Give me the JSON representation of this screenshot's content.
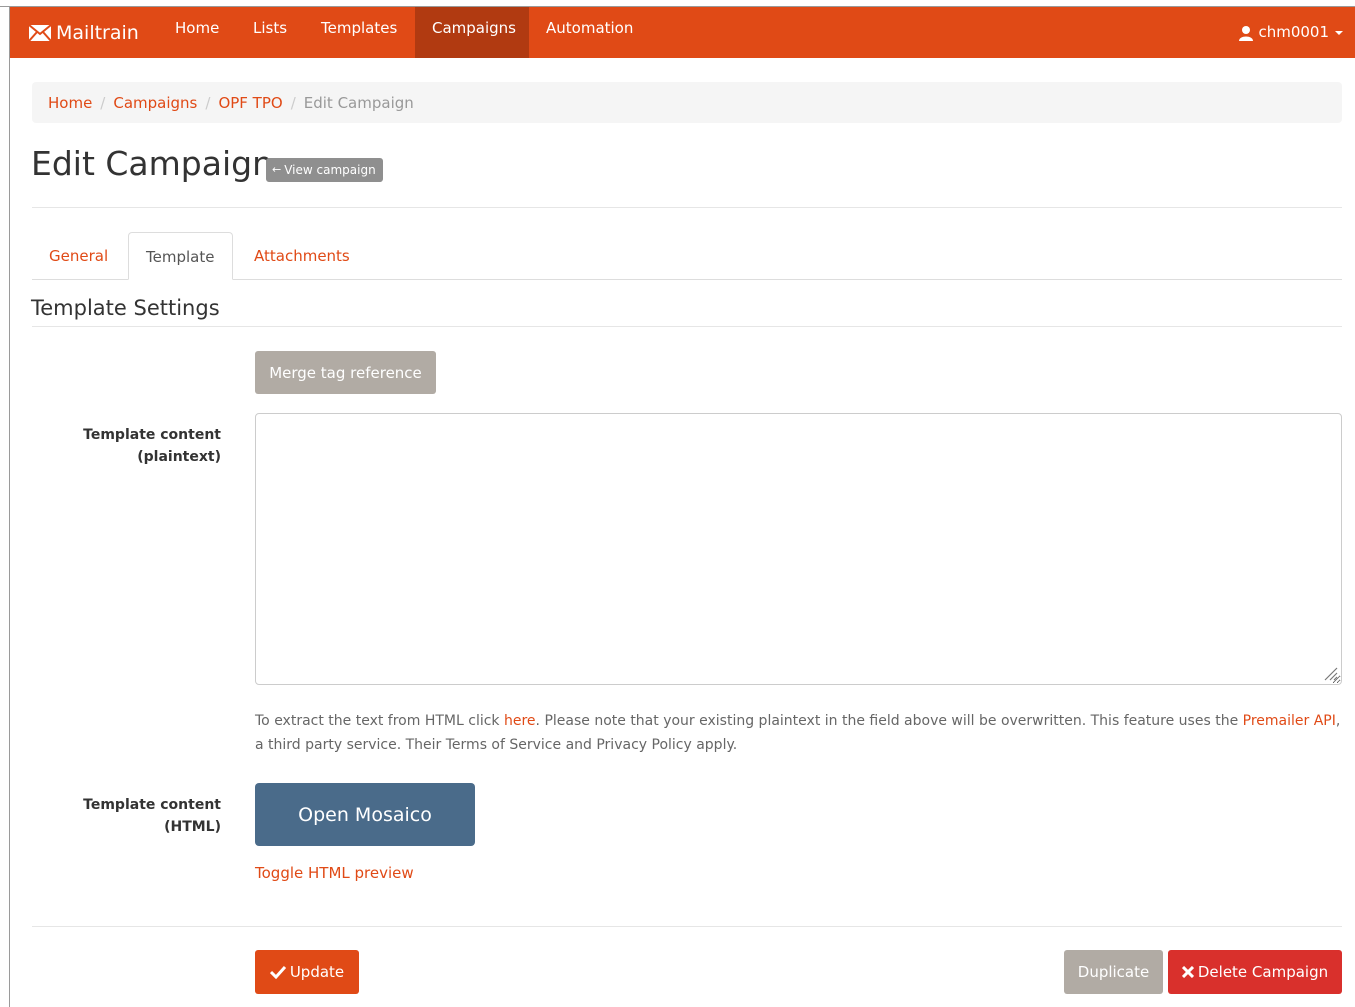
{
  "colors": {
    "accent": "#e04a16",
    "nav_active": "#b13a11",
    "mosaico": "#4a6b8a",
    "danger": "#d9302c",
    "muted_button": "#b1aba4"
  },
  "navbar": {
    "brand": "Mailtrain",
    "items": [
      {
        "label": "Home"
      },
      {
        "label": "Lists"
      },
      {
        "label": "Templates"
      },
      {
        "label": "Campaigns"
      },
      {
        "label": "Automation"
      }
    ],
    "active_item": "Campaigns",
    "user": "chm0001"
  },
  "breadcrumb": {
    "items": [
      "Home",
      "Campaigns",
      "OPF TPO"
    ],
    "current": "Edit Campaign",
    "separator": "/"
  },
  "header": {
    "title": "Edit Campaign",
    "view_button": "View campaign"
  },
  "tabs": {
    "items": [
      {
        "label": "General"
      },
      {
        "label": "Template"
      },
      {
        "label": "Attachments"
      }
    ],
    "active": "Template"
  },
  "template_settings": {
    "title": "Template Settings",
    "merge_tag_button": "Merge tag reference",
    "plaintext_label_line1": "Template content",
    "plaintext_label_line2": "(plaintext)",
    "plaintext_value": "",
    "help_text_part1": "To extract the text from HTML click ",
    "help_link_here": "here",
    "help_text_part2": ". Please note that your existing plaintext in the field above will be overwritten. This feature uses the ",
    "help_link_premailer": "Premailer API",
    "help_text_part3": ", a third party service. Their Terms of Service and Privacy Policy apply.",
    "html_label_line1": "Template content",
    "html_label_line2": "(HTML)",
    "mosaico_button": "Open Mosaico",
    "toggle_preview": "Toggle HTML preview"
  },
  "actions": {
    "update": "Update",
    "duplicate": "Duplicate",
    "delete": "Delete Campaign"
  }
}
